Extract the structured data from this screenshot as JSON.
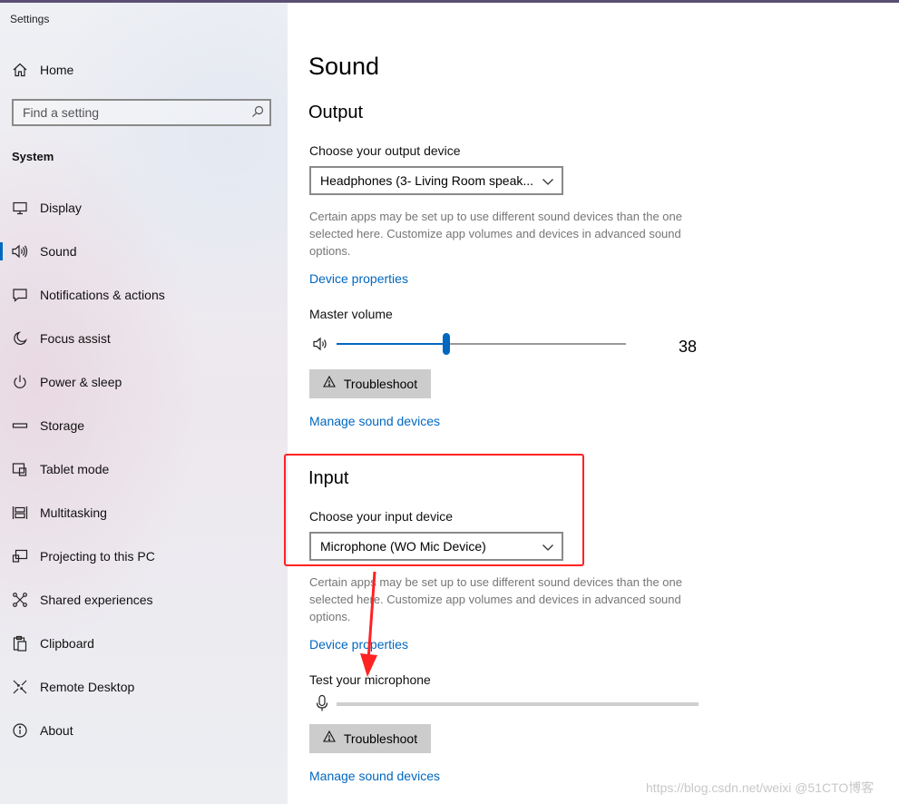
{
  "window": {
    "title": "Settings"
  },
  "sidebar": {
    "home": {
      "label": "Home",
      "icon": "home-icon"
    },
    "search": {
      "placeholder": "Find a setting",
      "icon": "search-icon"
    },
    "section": "System",
    "items": [
      {
        "label": "Display",
        "icon": "display-icon",
        "active": false
      },
      {
        "label": "Sound",
        "icon": "speaker-icon",
        "active": true
      },
      {
        "label": "Notifications & actions",
        "icon": "notifications-icon",
        "active": false
      },
      {
        "label": "Focus assist",
        "icon": "moon-icon",
        "active": false
      },
      {
        "label": "Power & sleep",
        "icon": "power-icon",
        "active": false
      },
      {
        "label": "Storage",
        "icon": "storage-icon",
        "active": false
      },
      {
        "label": "Tablet mode",
        "icon": "tablet-icon",
        "active": false
      },
      {
        "label": "Multitasking",
        "icon": "multitasking-icon",
        "active": false
      },
      {
        "label": "Projecting to this PC",
        "icon": "projector-icon",
        "active": false
      },
      {
        "label": "Shared experiences",
        "icon": "shared-icon",
        "active": false
      },
      {
        "label": "Clipboard",
        "icon": "clipboard-icon",
        "active": false
      },
      {
        "label": "Remote Desktop",
        "icon": "remote-desktop-icon",
        "active": false
      },
      {
        "label": "About",
        "icon": "info-icon",
        "active": false
      }
    ]
  },
  "main": {
    "title": "Sound",
    "output": {
      "heading": "Output",
      "device_label": "Choose your output device",
      "device_value": "Headphones (3- Living Room speak...",
      "description": "Certain apps may be set up to use different sound devices than the one selected here. Customize app volumes and devices in advanced sound options.",
      "device_properties": "Device properties",
      "volume_label": "Master volume",
      "volume_value": "38",
      "volume_percent": 38,
      "troubleshoot": "Troubleshoot",
      "manage": "Manage sound devices"
    },
    "input": {
      "heading": "Input",
      "device_label": "Choose your input device",
      "device_value": "Microphone (WO Mic Device)",
      "description": "Certain apps may be set up to use different sound devices than the one selected here. Customize app volumes and devices in advanced sound options.",
      "device_properties": "Device properties",
      "test_label": "Test your microphone",
      "mic_level_percent": 0,
      "troubleshoot": "Troubleshoot",
      "manage": "Manage sound devices"
    }
  },
  "annotation": {
    "highlight_color": "#ff2222"
  },
  "watermark": "https://blog.csdn.net/weixi @51CTO博客",
  "colors": {
    "accent": "#0067c0",
    "sidebar_bg": "#eceef2",
    "button_bg": "#cccccc"
  }
}
